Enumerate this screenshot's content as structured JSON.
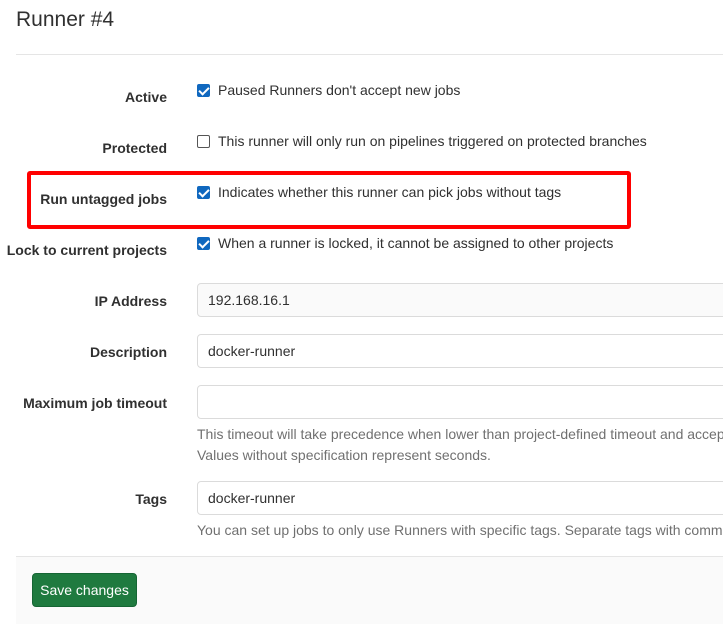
{
  "header": {
    "title": "Runner #4"
  },
  "form": {
    "active": {
      "label": "Active",
      "checked": true,
      "text": "Paused Runners don't accept new jobs"
    },
    "protected": {
      "label": "Protected",
      "checked": false,
      "text": "This runner will only run on pipelines triggered on protected branches"
    },
    "run_untagged": {
      "label": "Run untagged jobs",
      "checked": true,
      "text": "Indicates whether this runner can pick jobs without tags"
    },
    "locked": {
      "label": "Lock to current projects",
      "checked": true,
      "text": "When a runner is locked, it cannot be assigned to other projects"
    },
    "ip_address": {
      "label": "IP Address",
      "value": "192.168.16.1"
    },
    "description": {
      "label": "Description",
      "value": "docker-runner"
    },
    "timeout": {
      "label": "Maximum job timeout",
      "value": "",
      "help_line1": "This timeout will take precedence when lower than project-defined timeout and accep",
      "help_line2": "Values without specification represent seconds."
    },
    "tags": {
      "label": "Tags",
      "value": "docker-runner",
      "help": "You can set up jobs to only use Runners with specific tags. Separate tags with comma"
    }
  },
  "footer": {
    "save_label": "Save changes"
  },
  "colors": {
    "checkbox_accent": "#1068bf",
    "save_button": "#1f7a3f",
    "highlight_border": "#ff0000"
  }
}
